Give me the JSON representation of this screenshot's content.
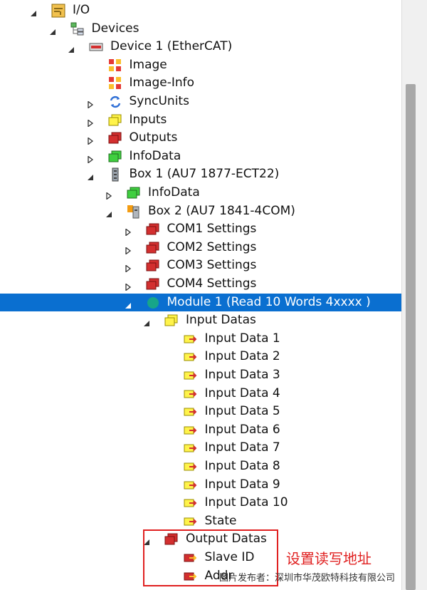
{
  "colors": {
    "selection": "#0a6fd0",
    "annotation": "#e02020"
  },
  "tree": [
    {
      "label": "I/O",
      "icon": "io-folder-icon",
      "expander": "expanded",
      "level": 0
    },
    {
      "label": "Devices",
      "icon": "devices-icon",
      "expander": "expanded",
      "level": 1
    },
    {
      "label": "Device 1 (EtherCAT)",
      "icon": "ethercat-device-icon",
      "expander": "expanded",
      "level": 2
    },
    {
      "label": "Image",
      "icon": "image-icon",
      "expander": "none",
      "level": 3
    },
    {
      "label": "Image-Info",
      "icon": "image-info-icon",
      "expander": "none",
      "level": 3
    },
    {
      "label": "SyncUnits",
      "icon": "sync-units-icon",
      "expander": "collapsed",
      "level": 3
    },
    {
      "label": "Inputs",
      "icon": "inputs-folder-icon",
      "expander": "collapsed",
      "level": 3
    },
    {
      "label": "Outputs",
      "icon": "outputs-folder-icon",
      "expander": "collapsed",
      "level": 3
    },
    {
      "label": "InfoData",
      "icon": "infodata-folder-icon",
      "expander": "collapsed",
      "level": 3
    },
    {
      "label": "Box 1 (AU7 1877-ECT22)",
      "icon": "box-coupler-icon",
      "expander": "expanded",
      "level": 3
    },
    {
      "label": "InfoData",
      "icon": "infodata-folder-icon",
      "expander": "collapsed",
      "level": 4
    },
    {
      "label": "Box 2 (AU7 1841-4COM)",
      "icon": "box-module-icon",
      "expander": "expanded",
      "level": 4
    },
    {
      "label": "COM1 Settings",
      "icon": "outputs-folder-icon",
      "expander": "collapsed",
      "level": 5
    },
    {
      "label": "COM2 Settings",
      "icon": "outputs-folder-icon",
      "expander": "collapsed",
      "level": 5
    },
    {
      "label": "COM3 Settings",
      "icon": "outputs-folder-icon",
      "expander": "collapsed",
      "level": 5
    },
    {
      "label": "COM4 Settings",
      "icon": "outputs-folder-icon",
      "expander": "collapsed",
      "level": 5
    },
    {
      "label": "Module 1 (Read 10 Words 4xxxx )",
      "icon": "module-dot-icon",
      "expander": "expanded",
      "level": 5,
      "selected": true
    },
    {
      "label": "Input Datas",
      "icon": "inputs-folder-icon",
      "expander": "expanded",
      "level": 6
    },
    {
      "label": "Input Data 1",
      "icon": "input-variable-icon",
      "expander": "none",
      "level": 7
    },
    {
      "label": "Input Data 2",
      "icon": "input-variable-icon",
      "expander": "none",
      "level": 7
    },
    {
      "label": "Input Data 3",
      "icon": "input-variable-icon",
      "expander": "none",
      "level": 7
    },
    {
      "label": "Input Data 4",
      "icon": "input-variable-icon",
      "expander": "none",
      "level": 7
    },
    {
      "label": "Input Data 5",
      "icon": "input-variable-icon",
      "expander": "none",
      "level": 7
    },
    {
      "label": "Input Data 6",
      "icon": "input-variable-icon",
      "expander": "none",
      "level": 7
    },
    {
      "label": "Input Data 7",
      "icon": "input-variable-icon",
      "expander": "none",
      "level": 7
    },
    {
      "label": "Input Data 8",
      "icon": "input-variable-icon",
      "expander": "none",
      "level": 7
    },
    {
      "label": "Input Data 9",
      "icon": "input-variable-icon",
      "expander": "none",
      "level": 7
    },
    {
      "label": "Input Data 10",
      "icon": "input-variable-icon",
      "expander": "none",
      "level": 7
    },
    {
      "label": "State",
      "icon": "input-variable-icon",
      "expander": "none",
      "level": 7
    },
    {
      "label": "Output Datas",
      "icon": "outputs-folder-icon",
      "expander": "expanded",
      "level": 6
    },
    {
      "label": "Slave ID",
      "icon": "output-variable-icon",
      "expander": "none",
      "level": 7
    },
    {
      "label": "Addr",
      "icon": "output-variable-icon",
      "expander": "none",
      "level": 7
    }
  ],
  "annotation": {
    "text": "设置读写地址"
  },
  "watermark": {
    "text": "图片发布者：深圳市华茂欧特科技有限公司"
  }
}
